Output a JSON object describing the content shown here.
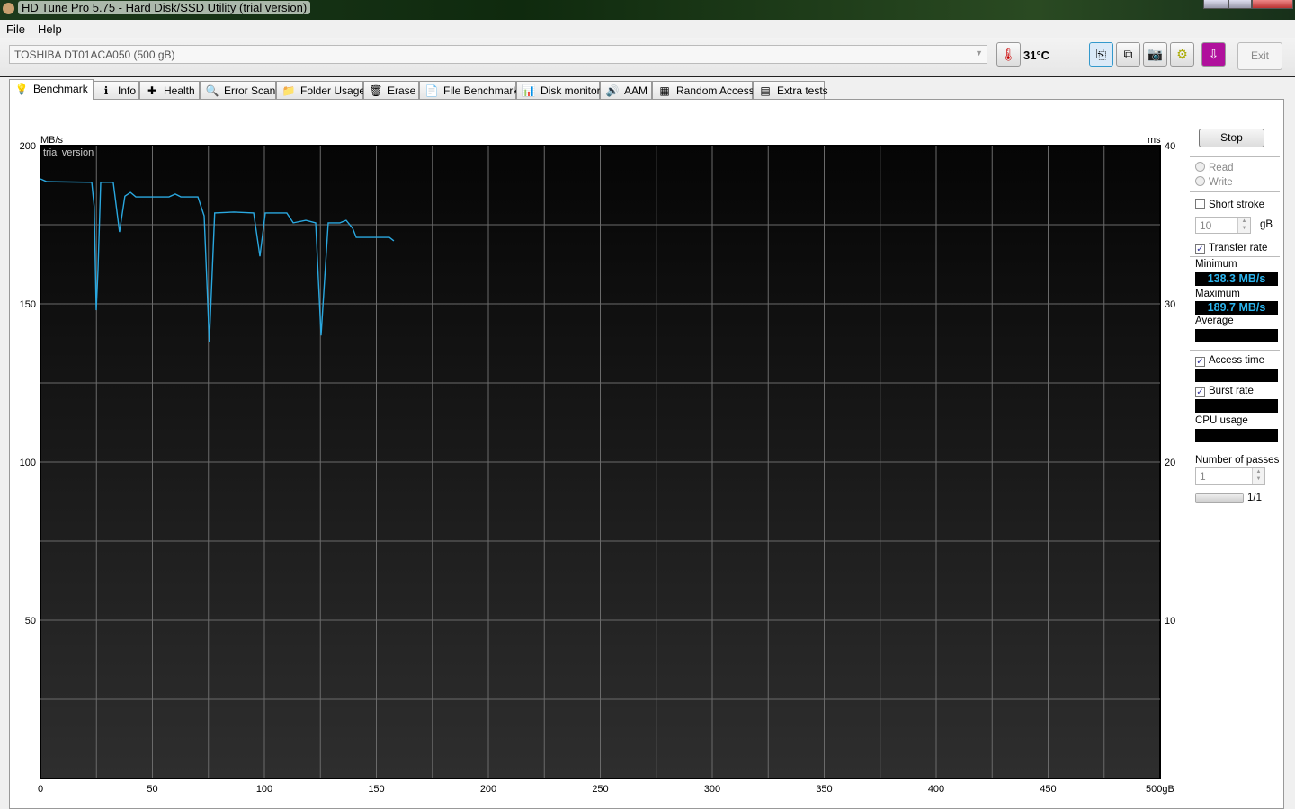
{
  "window": {
    "title": "HD Tune Pro 5.75 - Hard Disk/SSD Utility (trial version)"
  },
  "menu": {
    "file": "File",
    "help": "Help"
  },
  "toolbar": {
    "drive": "TOSHIBA DT01ACA050 (500 gB)",
    "temperature": "31°C",
    "exit": "Exit"
  },
  "tabs": [
    {
      "label": "Benchmark",
      "icon": "lightbulb-icon",
      "glyph": "💡"
    },
    {
      "label": "Info",
      "icon": "info-icon",
      "glyph": "ℹ"
    },
    {
      "label": "Health",
      "icon": "health-cross-icon",
      "glyph": "✚"
    },
    {
      "label": "Error Scan",
      "icon": "magnifier-icon",
      "glyph": "🔍"
    },
    {
      "label": "Folder Usage",
      "icon": "folder-icon",
      "glyph": "📁"
    },
    {
      "label": "Erase",
      "icon": "trash-icon",
      "glyph": "🗑"
    },
    {
      "label": "File Benchmark",
      "icon": "file-benchmark-icon",
      "glyph": "📄"
    },
    {
      "label": "Disk monitor",
      "icon": "bar-chart-icon",
      "glyph": "📊"
    },
    {
      "label": "AAM",
      "icon": "speaker-icon",
      "glyph": "🔊"
    },
    {
      "label": "Random Access",
      "icon": "random-access-icon",
      "glyph": "▦"
    },
    {
      "label": "Extra tests",
      "icon": "extra-tests-icon",
      "glyph": "▤"
    }
  ],
  "side": {
    "stop": "Stop",
    "read": "Read",
    "write": "Write",
    "short_stroke": "Short stroke",
    "short_stroke_value": "10",
    "gb": "gB",
    "transfer_rate": "Transfer rate",
    "minimum": "Minimum",
    "minimum_value": "138.3 MB/s",
    "maximum": "Maximum",
    "maximum_value": "189.7 MB/s",
    "average": "Average",
    "access_time": "Access time",
    "burst_rate": "Burst rate",
    "cpu_usage": "CPU usage",
    "passes": "Number of passes",
    "passes_value": "1",
    "progress": "1/1",
    "pass_progress": 1.0
  },
  "chart_data": {
    "type": "line",
    "watermark": "trial version",
    "ylabel": "MB/s",
    "y2label": "ms",
    "xlabel_suffix": "gB",
    "xlim": [
      0,
      500
    ],
    "ylim": [
      0,
      200
    ],
    "y2lim": [
      0,
      40
    ],
    "xticks": [
      "0",
      "50",
      "100",
      "150",
      "200",
      "250",
      "300",
      "350",
      "400",
      "450",
      "500gB"
    ],
    "yticks": [
      "50",
      "100",
      "150",
      "200"
    ],
    "y2ticks": [
      "10",
      "20",
      "30",
      "40"
    ],
    "color": "#2aa8e0",
    "series": [
      {
        "name": "Transfer rate",
        "x": [
          0,
          2.8,
          22.9,
          24,
          24.9,
          25.7,
          26.9,
          32.5,
          35.3,
          37.7,
          40.2,
          42.6,
          50.2,
          57.4,
          60.2,
          62.7,
          70.3,
          73.1,
          75.4,
          77.8,
          86.4,
          95.2,
          98,
          100.4,
          110,
          112.9,
          118.5,
          122.9,
          125.3,
          128.5,
          133.7,
          136.5,
          139.4,
          141,
          155.8,
          157.8
        ],
        "y": [
          189.5,
          188.6,
          188.4,
          180.7,
          148,
          160.8,
          188.4,
          188.4,
          172.7,
          184,
          185.2,
          183.8,
          183.8,
          183.8,
          184.7,
          183.8,
          183.8,
          177.8,
          138,
          178.7,
          179,
          178.7,
          165,
          178.7,
          178.7,
          175.6,
          176.4,
          175.6,
          140,
          175.6,
          175.6,
          176.4,
          173.9,
          171,
          171,
          169.9
        ]
      }
    ]
  }
}
